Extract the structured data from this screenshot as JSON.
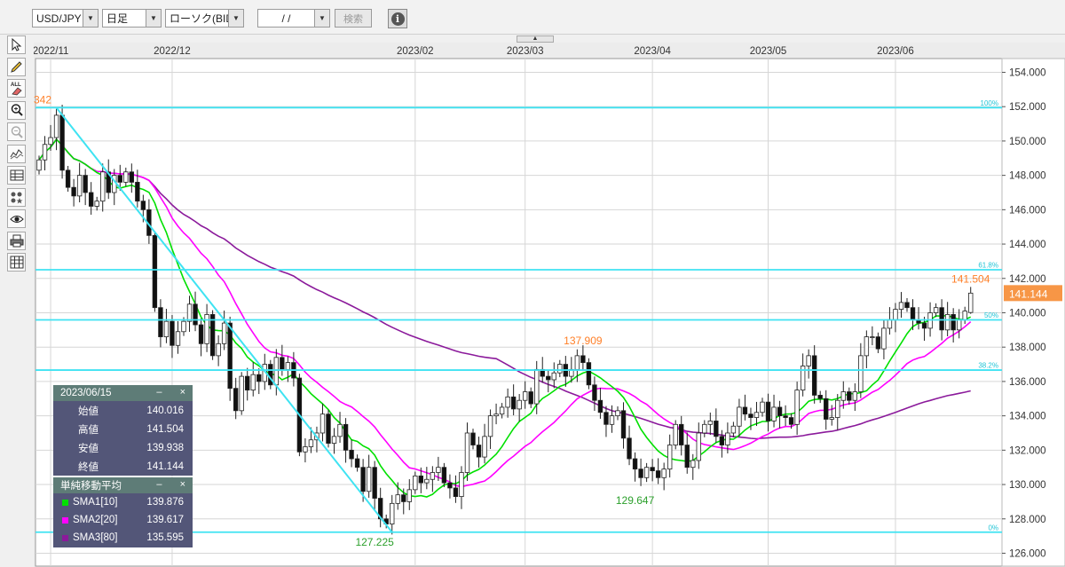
{
  "toolbar": {
    "symbol": "USD/JPY",
    "interval": "日足",
    "chart_type": "ローソク(BID)",
    "date_value": "/   /",
    "search_label": "検索",
    "info_glyph": "i",
    "dropdown_glyph": "▼"
  },
  "left_tools": [
    "cursor-icon",
    "pencil-icon",
    "all-eraser-icon",
    "zoom-in-icon",
    "zoom-out-icon",
    "indicator-icon",
    "data-window-icon",
    "display-settings-icon",
    "eye-icon",
    "print-icon",
    "table-icon"
  ],
  "tool_labels": {
    "all": "ALL"
  },
  "collapse_glyph": "▲",
  "ohlc_panel": {
    "date": "2023/06/15",
    "min_glyph": "–",
    "close_glyph": "×",
    "rows": [
      {
        "label": "始値",
        "value": "140.016"
      },
      {
        "label": "高値",
        "value": "141.504"
      },
      {
        "label": "安値",
        "value": "139.938"
      },
      {
        "label": "終値",
        "value": "141.144"
      }
    ]
  },
  "sma_panel": {
    "title": "単純移動平均",
    "rows": [
      {
        "label": "SMA1[10]",
        "value": "139.876",
        "color": "#00e000"
      },
      {
        "label": "SMA2[20]",
        "value": "139.617",
        "color": "#ff00ff"
      },
      {
        "label": "SMA3[80]",
        "value": "135.595",
        "color": "#8b1a9b"
      }
    ]
  },
  "chart_data": {
    "type": "candlestick",
    "ylim": [
      125,
      155
    ],
    "yticks": [
      "126.000",
      "128.000",
      "130.000",
      "132.000",
      "134.000",
      "136.000",
      "138.000",
      "140.000",
      "142.000",
      "144.000",
      "146.000",
      "148.000",
      "150.000",
      "152.000",
      "154.000"
    ],
    "xticks": [
      {
        "label": "2022/11",
        "idx": 2
      },
      {
        "label": "2022/12",
        "idx": 23
      },
      {
        "label": "2023/02",
        "idx": 65
      },
      {
        "label": "2023/03",
        "idx": 84
      },
      {
        "label": "2023/04",
        "idx": 106
      },
      {
        "label": "2023/05",
        "idx": 126
      },
      {
        "label": "2023/06",
        "idx": 148
      }
    ],
    "current_price": "141.144",
    "fib_levels": [
      {
        "label": "100%",
        "value": 151.942
      },
      {
        "label": "61.8%",
        "value": 142.503
      },
      {
        "label": "50%",
        "value": 139.584
      },
      {
        "label": "38.2%",
        "value": 136.665
      },
      {
        "label": "0%",
        "value": 127.225
      }
    ],
    "trendline": {
      "from": {
        "idx": 3,
        "price": 151.942
      },
      "to": {
        "idx": 61,
        "price": 127.225
      }
    },
    "annotations": [
      {
        "text": "342",
        "idx": 0.5,
        "price": 151.942,
        "color": "#ff7f27"
      },
      {
        "text": "127.225",
        "idx": 58,
        "price": 127.225,
        "color": "#2ca02c"
      },
      {
        "text": "137.909",
        "idx": 94,
        "price": 137.909,
        "color": "#ff7f27"
      },
      {
        "text": "129.647",
        "idx": 103,
        "price": 129.647,
        "color": "#2ca02c"
      },
      {
        "text": "141.504",
        "idx": 161,
        "price": 141.504,
        "color": "#ff7f27"
      }
    ],
    "candle_close": [
      148.9,
      149.8,
      150.2,
      151.5,
      148.3,
      147.3,
      146.8,
      148.0,
      147.0,
      146.2,
      146.5,
      148.2,
      147.0,
      148.0,
      147.6,
      148.2,
      147.6,
      146.5,
      146.0,
      144.5,
      140.3,
      138.6,
      139.5,
      138.1,
      138.9,
      139.5,
      140.5,
      139.3,
      138.2,
      139.9,
      137.5,
      138.2,
      139.4,
      135.6,
      134.3,
      136.3,
      135.5,
      136.4,
      136.0,
      137.0,
      135.8,
      137.4,
      136.7,
      137.1,
      136.2,
      131.9,
      132.2,
      132.6,
      133.0,
      134.1,
      132.4,
      132.8,
      133.5,
      132.0,
      131.5,
      131.0,
      129.6,
      131.0,
      129.2,
      128.0,
      127.7,
      128.9,
      129.4,
      129.0,
      129.7,
      130.5,
      130.1,
      130.3,
      130.7,
      131.0,
      130.1,
      129.8,
      129.3,
      130.7,
      133.0,
      132.3,
      131.6,
      132.8,
      134.0,
      134.1,
      134.5,
      135.1,
      134.4,
      134.9,
      135.4,
      134.7,
      136.7,
      136.3,
      136.1,
      136.5,
      137.0,
      136.3,
      136.7,
      137.5,
      137.1,
      135.8,
      134.9,
      134.2,
      133.5,
      134.0,
      134.3,
      132.7,
      131.5,
      130.9,
      130.4,
      131.0,
      130.8,
      130.4,
      130.9,
      132.3,
      133.5,
      132.3,
      131.0,
      131.4,
      133.0,
      133.5,
      133.7,
      132.8,
      132.3,
      133.0,
      133.4,
      134.5,
      134.1,
      133.9,
      134.2,
      134.8,
      133.7,
      134.5,
      134.0,
      133.9,
      133.5,
      135.5,
      136.9,
      137.5,
      135.2,
      135.0,
      133.8,
      133.9,
      134.9,
      135.4,
      134.9,
      135.4,
      137.5,
      138.6,
      138.6,
      137.9,
      139.1,
      139.6,
      140.2,
      140.6,
      140.3,
      139.6,
      139.4,
      139.1,
      140.0,
      140.3,
      139.0,
      139.9,
      139.0,
      139.6,
      140.1,
      141.144
    ]
  }
}
